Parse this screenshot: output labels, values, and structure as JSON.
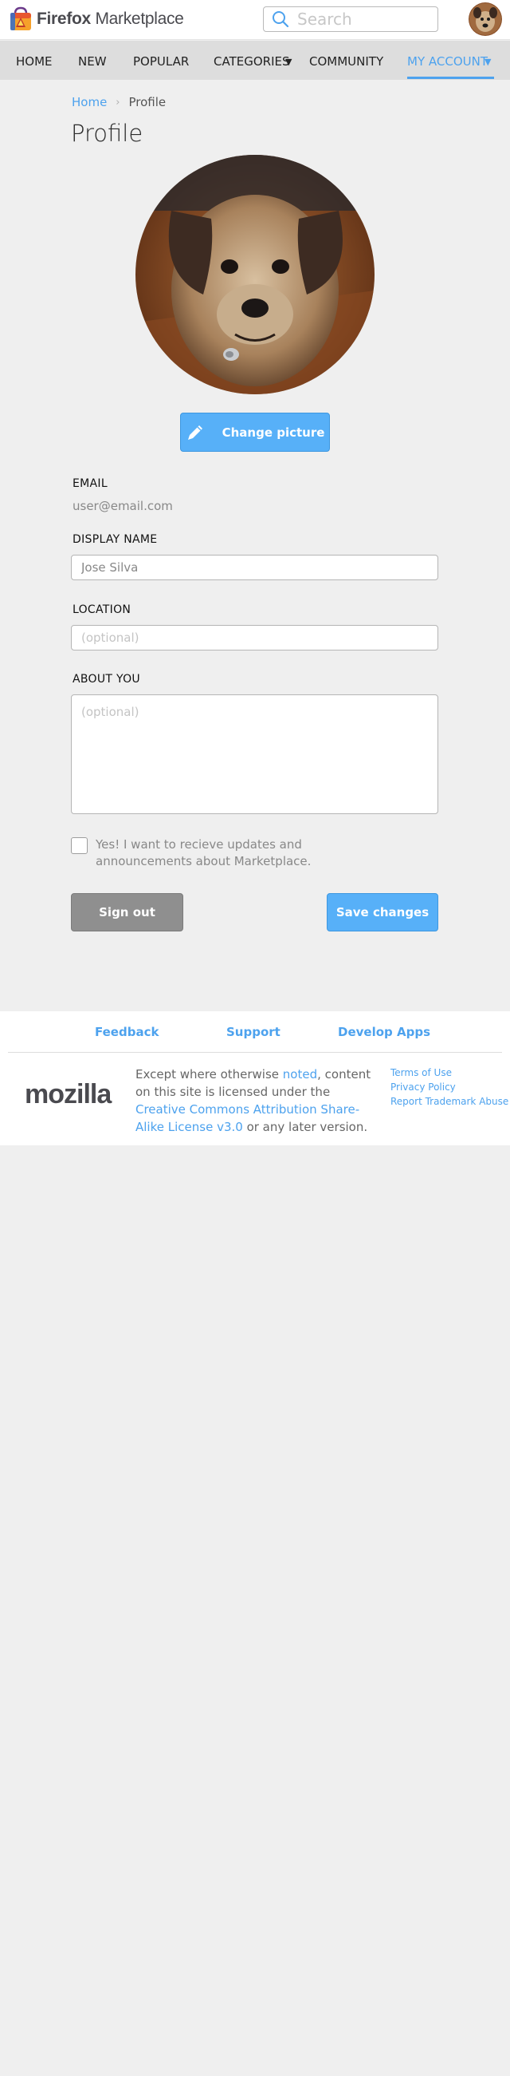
{
  "header": {
    "logo_brand": "Firefox",
    "logo_product": "Marketplace",
    "search_placeholder": "Search"
  },
  "nav": {
    "items": [
      {
        "label": "HOME"
      },
      {
        "label": "NEW"
      },
      {
        "label": "POPULAR"
      },
      {
        "label": "CATEGORIES"
      },
      {
        "label": "COMMUNITY"
      },
      {
        "label": "MY ACCOUNT"
      }
    ],
    "active": "MY ACCOUNT"
  },
  "breadcrumb": {
    "home": "Home",
    "current": "Profile"
  },
  "page": {
    "title": "Profile",
    "change_picture": "Change picture"
  },
  "form": {
    "email_label": "EMAIL",
    "email_value": "user@email.com",
    "display_name_label": "DISPLAY NAME",
    "display_name_value": "Jose Silva",
    "location_label": "LOCATION",
    "location_placeholder": "(optional)",
    "about_label": "ABOUT YOU",
    "about_placeholder": "(optional)",
    "updates_label": "Yes! I want to recieve updates and announcements about Marketplace.",
    "updates_checked": false,
    "sign_out": "Sign out",
    "save": "Save changes"
  },
  "footer": {
    "links": [
      {
        "label": "Feedback"
      },
      {
        "label": "Support"
      },
      {
        "label": "Develop Apps"
      }
    ],
    "mozilla": "mozilla",
    "license_pre": "Except where otherwise ",
    "license_noted": "noted",
    "license_mid": ", content on this site is licensed under the ",
    "license_link": "Creative Commons Attribution Share-Alike License v3.0",
    "license_post": " or any later version.",
    "legal": [
      {
        "label": "Terms of Use"
      },
      {
        "label": "Privacy Policy"
      },
      {
        "label": "Report Trademark Abuse"
      }
    ]
  },
  "colors": {
    "accent": "#4da2ee",
    "button_primary": "#57b0f8",
    "button_secondary": "#8f8f8f",
    "nav_bg": "#dddddd",
    "page_bg": "#efefef"
  }
}
